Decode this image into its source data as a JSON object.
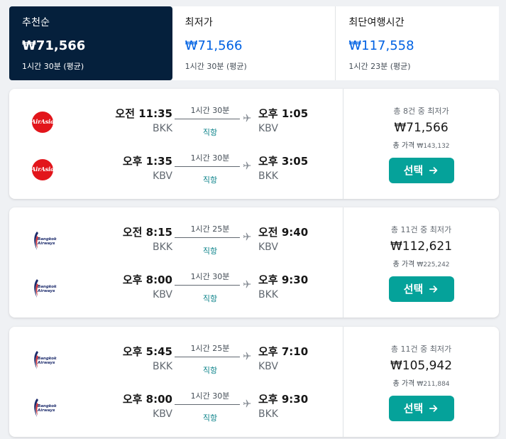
{
  "sort_tabs": [
    {
      "label": "추천순",
      "price": "₩71,566",
      "duration": "1시간 30분 (평균)"
    },
    {
      "label": "최저가",
      "price": "₩71,566",
      "duration": "1시간 30분 (평균)"
    },
    {
      "label": "최단여행시간",
      "price": "₩117,558",
      "duration": "1시간 23분 (평균)"
    }
  ],
  "results": [
    {
      "legs": [
        {
          "airline_icon": "airasia-logo",
          "airline_logo_text": "AirAsia",
          "dep_time": "오전 11:35",
          "dep_code": "BKK",
          "duration": "1시간 30분",
          "stops": "직항",
          "arr_time": "오후 1:05",
          "arr_code": "KBV"
        },
        {
          "airline_icon": "airasia-logo",
          "airline_logo_text": "AirAsia",
          "dep_time": "오후 1:35",
          "dep_code": "KBV",
          "duration": "1시간 30분",
          "stops": "직항",
          "arr_time": "오후 3:05",
          "arr_code": "BKK"
        }
      ],
      "cheapest_label": "총 8건 중 최저가",
      "price": "₩71,566",
      "total_label": "총 가격",
      "total_value": "₩143,132",
      "select_label": "선택"
    },
    {
      "legs": [
        {
          "airline_icon": "bangkok-airways-logo",
          "airline_logo_text": "Bangkok Airways",
          "dep_time": "오전 8:15",
          "dep_code": "BKK",
          "duration": "1시간 25분",
          "stops": "직항",
          "arr_time": "오전 9:40",
          "arr_code": "KBV"
        },
        {
          "airline_icon": "bangkok-airways-logo",
          "airline_logo_text": "Bangkok Airways",
          "dep_time": "오후 8:00",
          "dep_code": "KBV",
          "duration": "1시간 30분",
          "stops": "직항",
          "arr_time": "오후 9:30",
          "arr_code": "BKK"
        }
      ],
      "cheapest_label": "총 11건 중 최저가",
      "price": "₩112,621",
      "total_label": "총 가격",
      "total_value": "₩225,242",
      "select_label": "선택"
    },
    {
      "legs": [
        {
          "airline_icon": "bangkok-airways-logo",
          "airline_logo_text": "Bangkok Airways",
          "dep_time": "오후 5:45",
          "dep_code": "BKK",
          "duration": "1시간 25분",
          "stops": "직항",
          "arr_time": "오후 7:10",
          "arr_code": "KBV"
        },
        {
          "airline_icon": "bangkok-airways-logo",
          "airline_logo_text": "Bangkok Airways",
          "dep_time": "오후 8:00",
          "dep_code": "KBV",
          "duration": "1시간 30분",
          "stops": "직항",
          "arr_time": "오후 9:30",
          "arr_code": "BKK"
        }
      ],
      "cheapest_label": "총 11건 중 최저가",
      "price": "₩105,942",
      "total_label": "총 가격",
      "total_value": "₩211,884",
      "select_label": "선택"
    }
  ],
  "colors": {
    "active_tab_bg": "#05203c",
    "price_link": "#0062e3",
    "select_button": "#05a29a",
    "direct_text": "#0c838a",
    "airasia_red": "#e2151b",
    "bangkok_navy": "#1b2a6b"
  }
}
